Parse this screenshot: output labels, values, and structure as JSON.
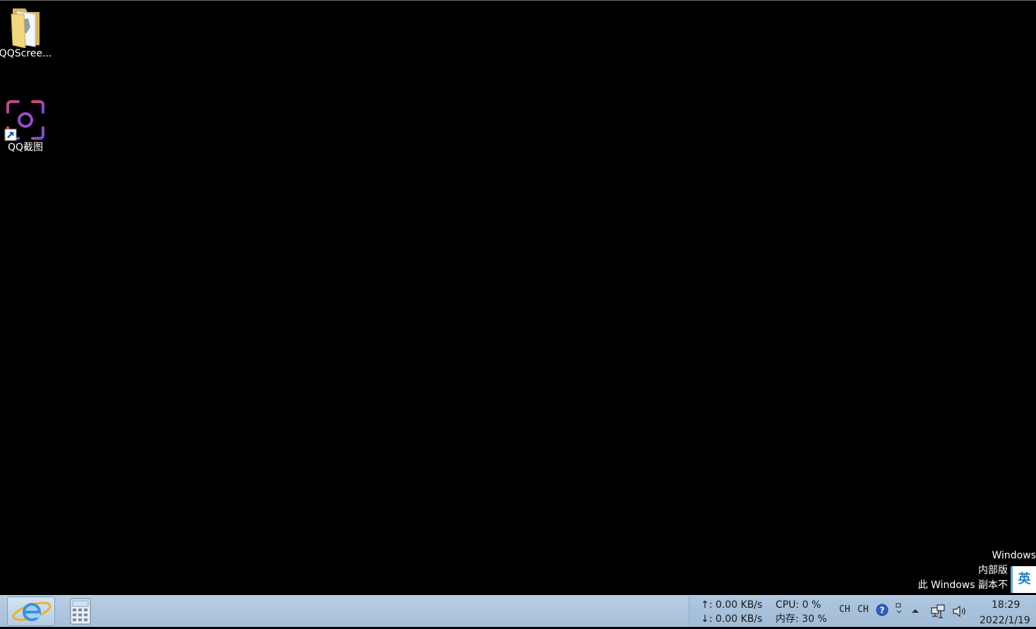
{
  "desktop": {
    "icons": [
      {
        "label": "QQScree..."
      },
      {
        "label": "QQ截图"
      }
    ]
  },
  "watermark": {
    "line1": "Windows",
    "line2": "内部版",
    "line3": "此 Windows 副本不"
  },
  "ime_indicator": "英",
  "taskbar": {
    "tray": {
      "net_up": "↑: 0.00 KB/s",
      "net_down": "↓: 0.00 KB/s",
      "cpu": "CPU: 0 %",
      "memory": "内存: 30 %",
      "ime_1": "CH",
      "ime_2": "CH",
      "time": "18:29",
      "date": "2022/1/19"
    }
  },
  "colors": {
    "desktop_bg": "#000000",
    "taskbar": "#a6c0da",
    "ime_accent": "#1e82c8"
  }
}
